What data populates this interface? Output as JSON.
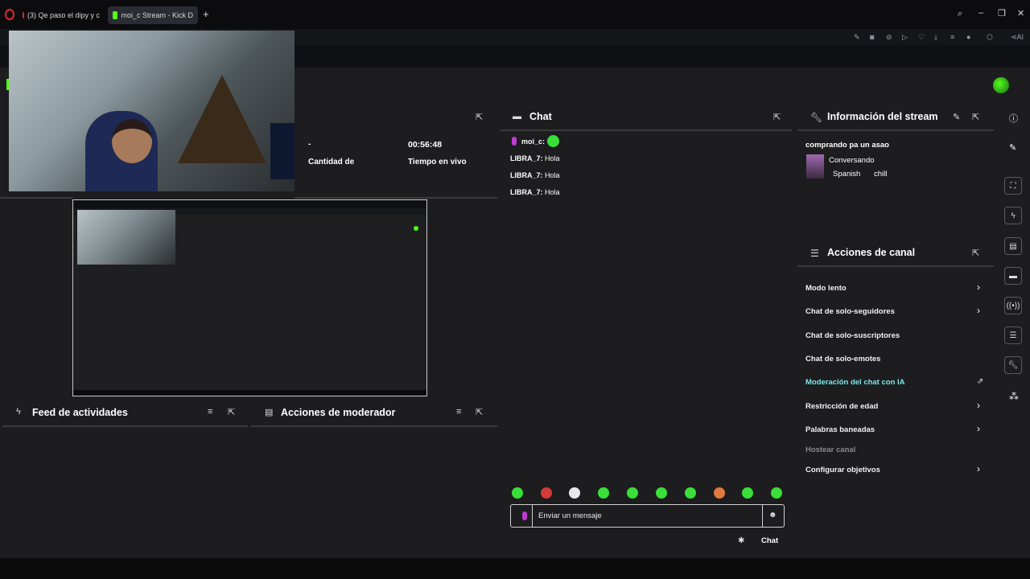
{
  "browser": {
    "tab1_label": "(3) Qe paso el dipy y c",
    "tab2_label": "moi_c Stream - Kick D",
    "new_tab": "+",
    "window_controls": [
      "⌕",
      "–",
      "❐",
      "✕"
    ]
  },
  "stats": {
    "value_left": "-",
    "label_left": "Cantidad de",
    "value_right": "00:56:48",
    "label_right": "Tiempo en vivo"
  },
  "chat": {
    "title": "Chat",
    "streamer": "moi_c:",
    "messages": [
      {
        "user": "LIBRA_7:",
        "text": "Hola"
      },
      {
        "user": "LIBRA_7:",
        "text": "Hola"
      },
      {
        "user": "LIBRA_7:",
        "text": "Hola"
      }
    ],
    "input_placeholder": "Enviar un mensaje",
    "send_label": "Chat",
    "emote_count": 10
  },
  "stream_info": {
    "title": "Información del stream",
    "stream_title": "comprando pa un asao",
    "category": "Conversando",
    "language": "Spanish",
    "tag": "chill"
  },
  "channel_actions": {
    "title": "Acciones de canal",
    "items": [
      {
        "label": "Modo lento",
        "chevron": true
      },
      {
        "label": "Chat de solo-seguidores",
        "chevron": true
      },
      {
        "label": "Chat de solo-suscriptores",
        "chevron": false
      },
      {
        "label": "Chat de solo-emotes",
        "chevron": false
      },
      {
        "label": "Moderación del chat con IA",
        "chevron": false,
        "accent": "#7de3e8"
      },
      {
        "label": "Restricción de edad",
        "chevron": true
      },
      {
        "label": "Palabras baneadas",
        "chevron": true
      },
      {
        "label": "Hostear canal",
        "chevron": false,
        "muted": true
      },
      {
        "label": "Configurar objetivos",
        "chevron": true
      }
    ]
  },
  "feed": {
    "title": "Feed de actividades"
  },
  "mod_actions": {
    "title": "Acciones de moderador"
  },
  "colors": {
    "page_bg": "#1d1d1f",
    "kick_green": "#53fc18",
    "accent_cyan": "#7de3e8"
  }
}
